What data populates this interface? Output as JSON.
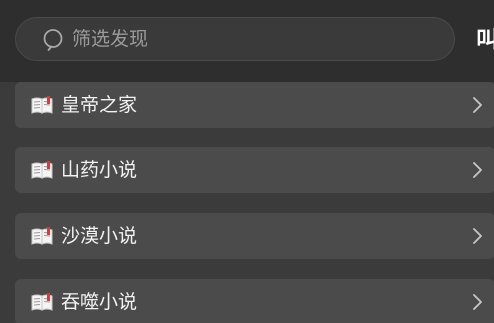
{
  "search": {
    "placeholder": "筛选发现",
    "value": ""
  },
  "header": {
    "menu_partial": "叫"
  },
  "items": [
    {
      "icon": "book-icon",
      "label": "皇帝之家"
    },
    {
      "icon": "book-icon",
      "label": "山药小说"
    },
    {
      "icon": "book-icon",
      "label": "沙漠小说"
    },
    {
      "icon": "book-icon",
      "label": "吞噬小说"
    }
  ],
  "colors": {
    "background": "#3b3b3b",
    "topbar": "#2e2e2e",
    "row": "#4b4b4b",
    "text": "#f2f2f2",
    "placeholder": "#9a9a9a"
  }
}
